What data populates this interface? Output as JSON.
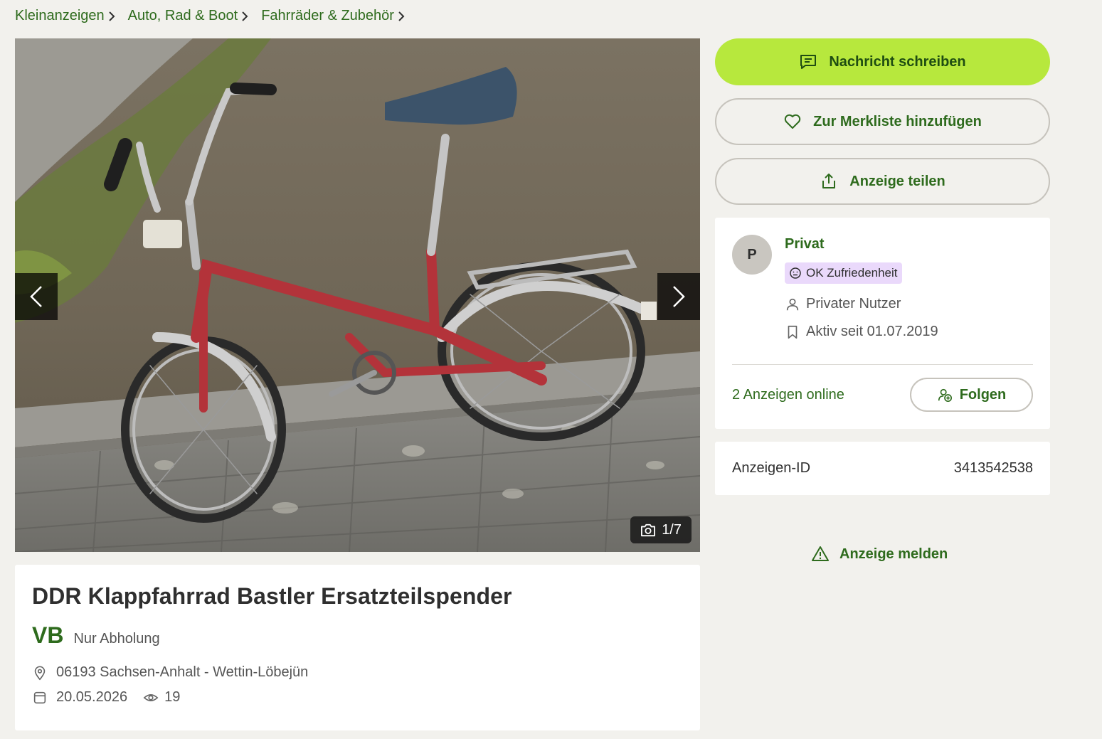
{
  "breadcrumb": [
    {
      "label": "Kleinanzeigen"
    },
    {
      "label": "Auto, Rad & Boot"
    },
    {
      "label": "Fahrräder & Zubehör"
    }
  ],
  "gallery": {
    "counter": "1/7"
  },
  "listing": {
    "title": "DDR Klappfahrrad Bastler Ersatzteilspender",
    "price": "VB",
    "shipping": "Nur Abholung",
    "location": "06193 Sachsen-Anhalt - Wettin-Löbejün",
    "date": "20.05.2026",
    "views": "19"
  },
  "actions": {
    "message_label": "Nachricht schreiben",
    "watchlist_label": "Zur Merkliste hinzufügen",
    "share_label": "Anzeige teilen",
    "report_label": "Anzeige melden"
  },
  "seller": {
    "avatar_letter": "P",
    "name": "Privat",
    "satisfaction": "OK Zufriedenheit",
    "user_type": "Privater Nutzer",
    "active_since": "Aktiv seit 01.07.2019",
    "ads_online": "2 Anzeigen online",
    "follow_label": "Folgen"
  },
  "ad_id": {
    "label": "Anzeigen-ID",
    "value": "3413542538"
  },
  "colors": {
    "accent_green": "#2e6b1d",
    "primary_button": "#b7e83d",
    "badge_purple": "#ead9fb",
    "background": "#f2f1ed"
  },
  "icons": {
    "breadcrumb_separator": "chevron-right-icon",
    "message": "message-icon",
    "watchlist": "heart-icon",
    "share": "share-icon",
    "report": "warning-icon",
    "location": "location-pin-icon",
    "date": "calendar-icon",
    "views": "eye-icon",
    "camera": "camera-icon",
    "user": "user-icon",
    "bookmark": "bookmark-icon",
    "follow": "user-plus-icon",
    "satisfaction": "smiley-icon"
  }
}
